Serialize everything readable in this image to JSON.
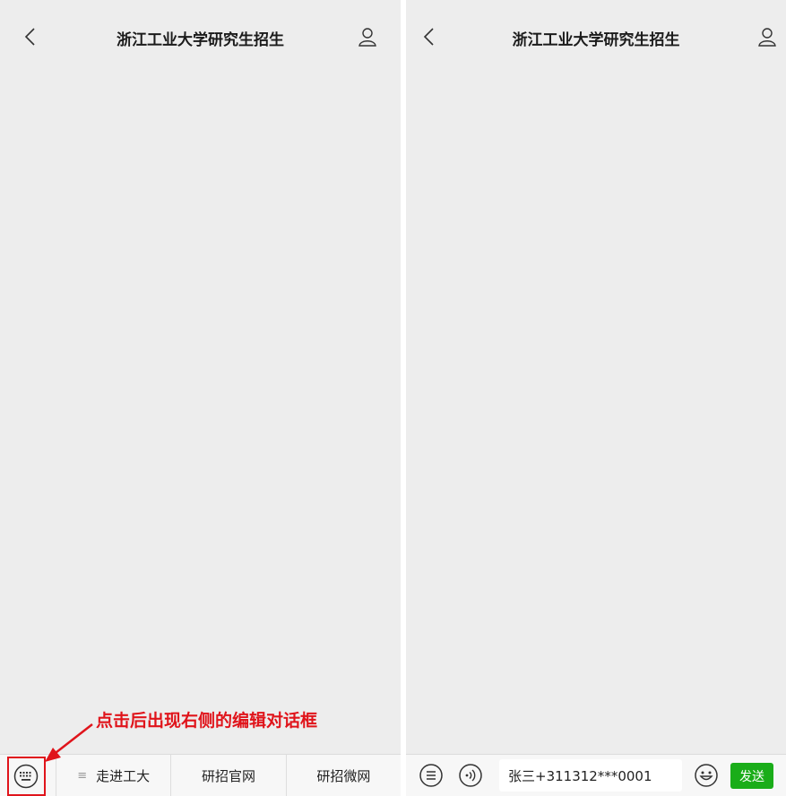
{
  "left_panel": {
    "header": {
      "title": "浙江工业大学研究生招生"
    },
    "menu_mark": "≡",
    "tabs": [
      {
        "label": "走进工大"
      },
      {
        "label": "研招官网"
      },
      {
        "label": "研招微网"
      }
    ]
  },
  "annotation": {
    "text": "点击后出现右侧的编辑对话框",
    "color": "#e0141b"
  },
  "right_panel": {
    "header": {
      "title": "浙江工业大学研究生招生"
    },
    "input": {
      "value": "张三+311312***0001"
    },
    "send_label": "发送",
    "send_color": "#1aad19"
  }
}
